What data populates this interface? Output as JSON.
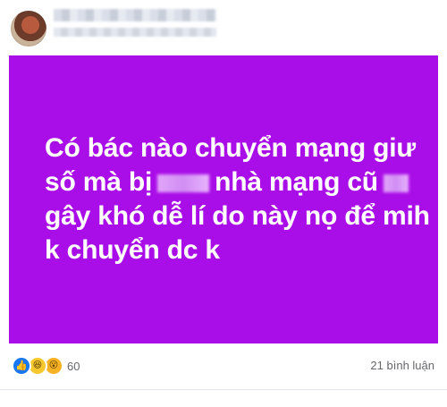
{
  "post": {
    "lines": [
      {
        "text": "Có bác nào chuyển mạng giư"
      },
      {
        "before": "số mà bị",
        "after": "nhà mạng cũ"
      },
      {
        "text": "gây khó dễ lí do này nọ để mih"
      },
      {
        "text": "k chuyển dc k"
      }
    ],
    "background_color": "#aa0ee8"
  },
  "reactions": {
    "icons": [
      "like-icon",
      "haha-icon",
      "wow-icon"
    ],
    "count": "60"
  },
  "comments": {
    "label": "21 bình luận"
  }
}
